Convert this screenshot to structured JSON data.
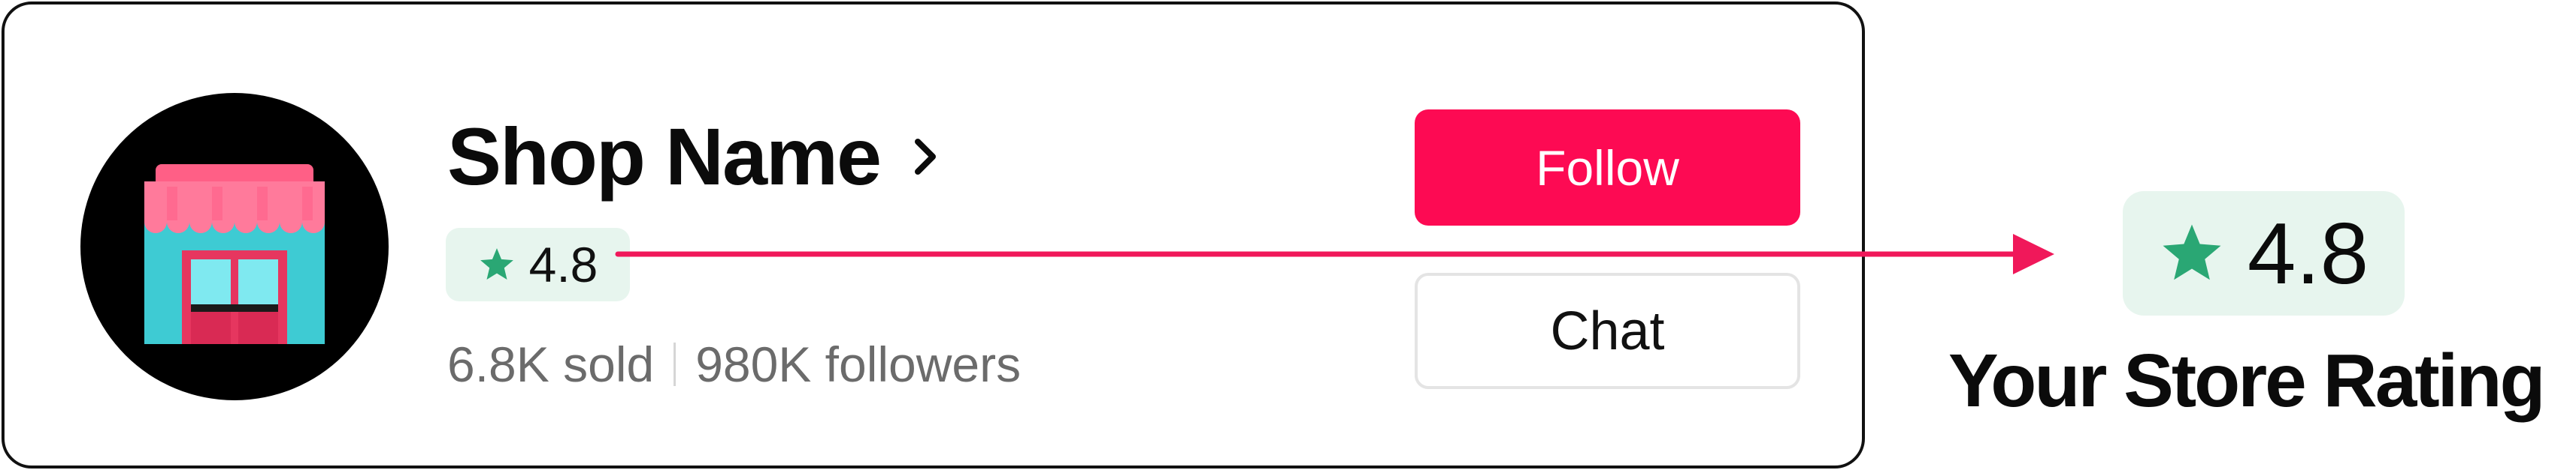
{
  "shop_card": {
    "shop_name": "Shop Name",
    "avatar_icon": "storefront-icon",
    "rating": "4.8",
    "sold": "6.8K sold",
    "followers": "980K followers",
    "follow_label": "Follow",
    "chat_label": "Chat"
  },
  "callout": {
    "rating": "4.8",
    "caption": "Your Store Rating"
  },
  "colors": {
    "accent": "#fd0a53",
    "rating_badge_bg": "#e7f5ee",
    "star": "#2aa774",
    "text_primary": "#0b0b0b",
    "text_secondary": "#6b6b6b",
    "chat_border": "#e4e4e4"
  }
}
